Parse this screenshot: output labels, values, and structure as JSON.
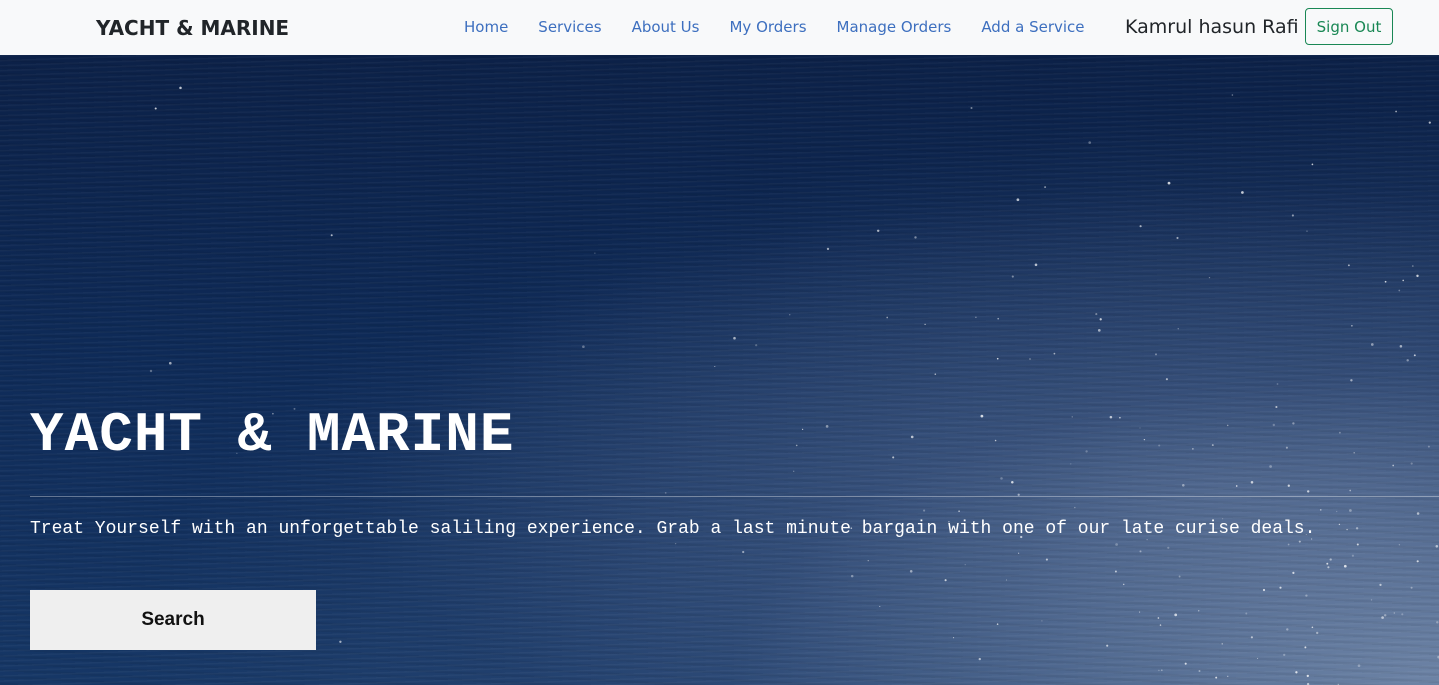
{
  "navbar": {
    "brand": "YACHT & MARINE",
    "links": [
      {
        "label": "Home"
      },
      {
        "label": "Services"
      },
      {
        "label": "About Us"
      },
      {
        "label": "My Orders"
      },
      {
        "label": "Manage Orders"
      },
      {
        "label": "Add a Service"
      }
    ],
    "user_name": "Kamrul hasun Rafi",
    "signout_label": "Sign Out"
  },
  "hero": {
    "title": "YACHT & MARINE",
    "description": "Treat Yourself with an unforgettable saliling experience. Grab a last minute bargain with one of our late curise deals.",
    "search_label": "Search"
  },
  "colors": {
    "link": "#3d6fbf",
    "signout": "#198754",
    "navbar_bg": "#f8f9fa",
    "hero_bg": "#0e2a57"
  }
}
